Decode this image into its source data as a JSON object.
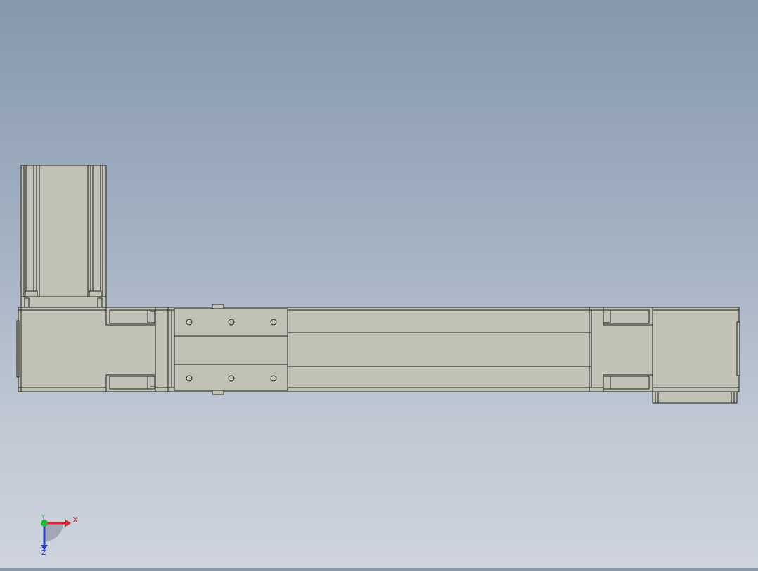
{
  "viewport": {
    "background_top": "#8798ad",
    "background_bottom": "#cfd4de",
    "part_fill": "#c1c1b6",
    "part_edge": "#1e1e1e"
  },
  "triad": {
    "x_label": "X",
    "y_label": "Y",
    "z_label": "Z",
    "x_color": "#e0262a",
    "y_color": "#1fb93a",
    "z_color": "#2a3fd0"
  }
}
